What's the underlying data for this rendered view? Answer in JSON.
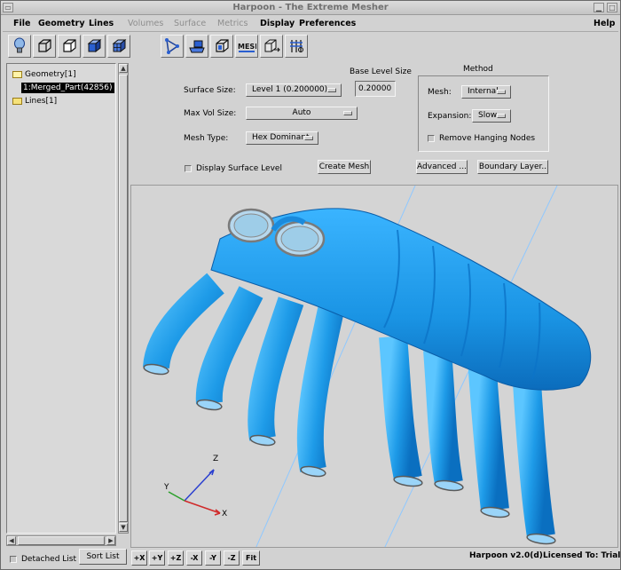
{
  "window": {
    "title": "Harpoon - The Extreme Mesher"
  },
  "menu": {
    "file": "File",
    "geometry": "Geometry",
    "lines": "Lines",
    "volumes": "Volumes",
    "surface": "Surface",
    "metrics": "Metrics",
    "display": "Display",
    "preferences": "Preferences",
    "help": "Help"
  },
  "tree": {
    "geometry": "Geometry[1]",
    "selected_part": "1:Merged_Part(42856)",
    "lines": "Lines[1]"
  },
  "settings": {
    "surface_size_label": "Surface Size:",
    "surface_size_value": "Level 1 (0.200000)",
    "base_level_size_label": "Base Level Size",
    "base_level_size_value": "0.20000",
    "max_vol_size_label": "Max Vol Size:",
    "max_vol_size_value": "Auto",
    "mesh_type_label": "Mesh Type:",
    "mesh_type_value": "Hex Dominant",
    "display_surface_level": "Display Surface Level",
    "create_mesh": "Create Mesh",
    "advanced": "Advanced ...",
    "boundary_layer": "Boundary Layer.."
  },
  "method": {
    "title": "Method",
    "mesh_label": "Mesh:",
    "mesh_value": "Internal",
    "expansion_label": "Expansion:",
    "expansion_value": "Slow",
    "remove_hanging": "Remove Hanging Nodes"
  },
  "axes": {
    "x": "X",
    "y": "Y",
    "z": "Z"
  },
  "bottom": {
    "detached_list": "Detached List",
    "sort_list": "Sort List",
    "view_buttons": [
      "+X",
      "+Y",
      "+Z",
      "-X",
      "-Y",
      "-Z",
      "Fit"
    ],
    "version": "Harpoon v2.0(d)",
    "license": "Licensed To: Trial"
  },
  "colors": {
    "model": "#1e9be8",
    "model_dark": "#0a6fc0",
    "background": "#d2d2d2"
  }
}
